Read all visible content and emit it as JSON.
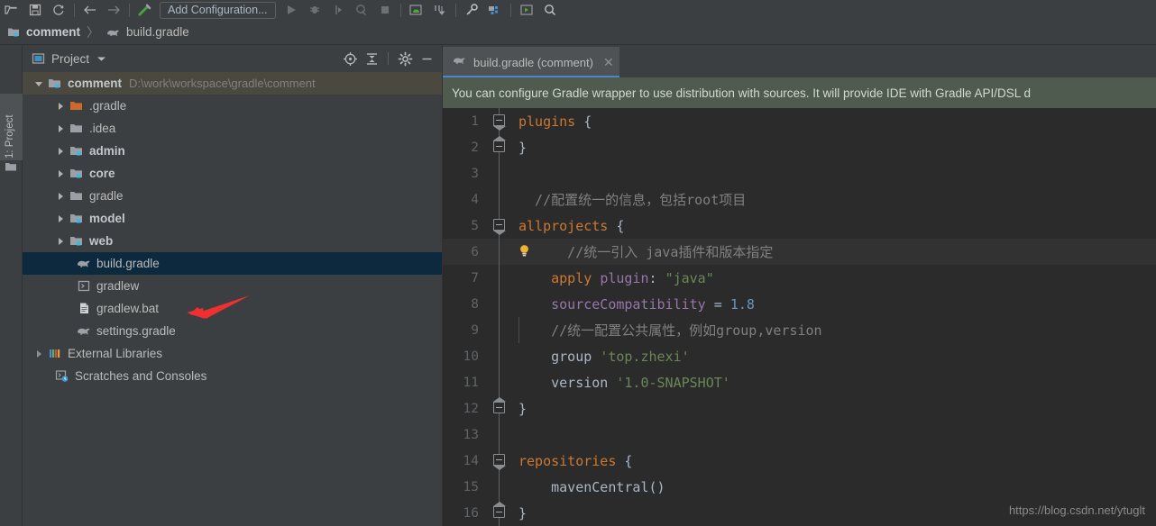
{
  "toolbar": {
    "icons": [
      {
        "name": "open-folder-icon"
      },
      {
        "name": "save-all-icon"
      },
      {
        "name": "sync-refresh-icon"
      },
      {
        "name": "back-arrow-icon"
      },
      {
        "name": "forward-arrow-icon"
      },
      {
        "name": "build-hammer-icon"
      }
    ],
    "run_config_label": "Add Configuration...",
    "right_icons": [
      {
        "name": "run-icon"
      },
      {
        "name": "debug-icon"
      },
      {
        "name": "run-with-coverage-icon"
      },
      {
        "name": "profile-icon"
      },
      {
        "name": "stop-icon"
      },
      {
        "name": "avd-manager-icon"
      },
      {
        "name": "sdk-manager-icon"
      },
      {
        "name": "search-everywhere-key-icon"
      },
      {
        "name": "project-structure-icon"
      },
      {
        "name": "run-anything-icon"
      },
      {
        "name": "search-icon"
      }
    ]
  },
  "breadcrumb": {
    "project_name": "comment",
    "separator": "〉",
    "file_name": "build.gradle"
  },
  "left_strip": {
    "project_tab_label": "1: Project",
    "structure_icon": "folder-icon"
  },
  "project_panel": {
    "title": "Project",
    "dropdown_icon": "chevron-down-icon",
    "actions": [
      {
        "name": "scroll-from-source-icon"
      },
      {
        "name": "collapse-all-icon"
      },
      {
        "name": "settings-gear-icon"
      },
      {
        "name": "hide-panel-icon"
      }
    ],
    "tree": [
      {
        "label": "comment",
        "path": "D:\\work\\workspace\\gradle\\comment",
        "icon": "module-folder-icon",
        "indent": 0,
        "arrow": "expanded",
        "bold": true,
        "state": "root"
      },
      {
        "label": ".gradle",
        "icon": "excluded-folder-icon",
        "indent": 1,
        "arrow": "collapsed",
        "bold": false,
        "state": "normal"
      },
      {
        "label": ".idea",
        "icon": "folder-icon",
        "indent": 1,
        "arrow": "collapsed",
        "bold": false,
        "state": "normal"
      },
      {
        "label": "admin",
        "icon": "module-folder-icon",
        "indent": 1,
        "arrow": "collapsed",
        "bold": true,
        "state": "normal"
      },
      {
        "label": "core",
        "icon": "module-folder-icon",
        "indent": 1,
        "arrow": "collapsed",
        "bold": true,
        "state": "normal"
      },
      {
        "label": "gradle",
        "icon": "folder-icon",
        "indent": 1,
        "arrow": "collapsed",
        "bold": false,
        "state": "normal"
      },
      {
        "label": "model",
        "icon": "module-folder-icon",
        "indent": 1,
        "arrow": "collapsed",
        "bold": true,
        "state": "normal"
      },
      {
        "label": "web",
        "icon": "module-folder-icon",
        "indent": 1,
        "arrow": "collapsed",
        "bold": true,
        "state": "normal"
      },
      {
        "label": "build.gradle",
        "icon": "gradle-elephant-icon",
        "indent": 2,
        "arrow": "none",
        "bold": false,
        "state": "selected"
      },
      {
        "label": "gradlew",
        "icon": "script-icon",
        "indent": 2,
        "arrow": "none",
        "bold": false,
        "state": "normal"
      },
      {
        "label": "gradlew.bat",
        "icon": "bat-file-icon",
        "indent": 2,
        "arrow": "none",
        "bold": false,
        "state": "normal"
      },
      {
        "label": "settings.gradle",
        "icon": "gradle-elephant-icon",
        "indent": 2,
        "arrow": "none",
        "bold": false,
        "state": "normal"
      },
      {
        "label": "External Libraries",
        "icon": "libraries-icon",
        "indent": 0,
        "arrow": "collapsed",
        "bold": false,
        "state": "normal"
      },
      {
        "label": "Scratches and Consoles",
        "icon": "scratches-icon",
        "indent": 1,
        "arrow": "none",
        "bold": false,
        "state": "normal"
      }
    ]
  },
  "editor": {
    "tab": {
      "icon": "gradle-elephant-icon",
      "label": "build.gradle (comment)",
      "close_icon": "close-icon"
    },
    "notification": "You can configure Gradle wrapper to use distribution with sources. It will provide IDE with Gradle API/DSL d",
    "lines": [
      {
        "no": "1",
        "fold": "open",
        "current": false,
        "bulb": false,
        "tokens": [
          {
            "t": "plugins",
            "c": "k"
          },
          {
            "t": " {",
            "c": "pl"
          }
        ]
      },
      {
        "no": "2",
        "fold": "close",
        "current": false,
        "bulb": false,
        "tokens": [
          {
            "t": "}",
            "c": "pl"
          }
        ]
      },
      {
        "no": "3",
        "fold": "none",
        "current": false,
        "bulb": false,
        "tokens": []
      },
      {
        "no": "4",
        "fold": "none",
        "current": false,
        "bulb": false,
        "tokens": [
          {
            "t": "  //配置统一的信息，包括root项目",
            "c": "com"
          }
        ]
      },
      {
        "no": "5",
        "fold": "open",
        "current": false,
        "bulb": false,
        "tokens": [
          {
            "t": "allprojects",
            "c": "k"
          },
          {
            "t": " {",
            "c": "pl"
          }
        ]
      },
      {
        "no": "6",
        "fold": "none",
        "current": true,
        "bulb": true,
        "tokens": [
          {
            "t": "      //统一引入 java插件和版本指定",
            "c": "com"
          }
        ]
      },
      {
        "no": "7",
        "fold": "none",
        "current": false,
        "bulb": false,
        "tokens": [
          {
            "t": "    ",
            "c": "pl"
          },
          {
            "t": "apply",
            "c": "k"
          },
          {
            "t": " ",
            "c": "pl"
          },
          {
            "t": "plugin",
            "c": "fld"
          },
          {
            "t": ": ",
            "c": "pl"
          },
          {
            "t": "\"java\"",
            "c": "str"
          }
        ]
      },
      {
        "no": "8",
        "fold": "none",
        "current": false,
        "bulb": false,
        "tokens": [
          {
            "t": "    ",
            "c": "pl"
          },
          {
            "t": "sourceCompatibility",
            "c": "fld"
          },
          {
            "t": " = ",
            "c": "pl"
          },
          {
            "t": "1.8",
            "c": "num"
          }
        ]
      },
      {
        "no": "9",
        "fold": "none",
        "current": false,
        "bulb": false,
        "tokens": [
          {
            "t": "    //统一配置公共属性，例如group,version",
            "c": "com"
          }
        ]
      },
      {
        "no": "10",
        "fold": "none",
        "current": false,
        "bulb": false,
        "tokens": [
          {
            "t": "    ",
            "c": "pl"
          },
          {
            "t": "group",
            "c": "fn"
          },
          {
            "t": " ",
            "c": "pl"
          },
          {
            "t": "'top.zhexi'",
            "c": "str"
          }
        ]
      },
      {
        "no": "11",
        "fold": "none",
        "current": false,
        "bulb": false,
        "tokens": [
          {
            "t": "    ",
            "c": "pl"
          },
          {
            "t": "version",
            "c": "fn"
          },
          {
            "t": " ",
            "c": "pl"
          },
          {
            "t": "'1.0-SNAPSHOT'",
            "c": "str"
          }
        ]
      },
      {
        "no": "12",
        "fold": "close",
        "current": false,
        "bulb": false,
        "tokens": [
          {
            "t": "}",
            "c": "pl"
          }
        ]
      },
      {
        "no": "13",
        "fold": "none",
        "current": false,
        "bulb": false,
        "tokens": []
      },
      {
        "no": "14",
        "fold": "open",
        "current": false,
        "bulb": false,
        "tokens": [
          {
            "t": "repositories",
            "c": "k"
          },
          {
            "t": " {",
            "c": "pl"
          }
        ]
      },
      {
        "no": "15",
        "fold": "none",
        "current": false,
        "bulb": false,
        "tokens": [
          {
            "t": "    ",
            "c": "pl"
          },
          {
            "t": "mavenCentral",
            "c": "fn"
          },
          {
            "t": "()",
            "c": "pl"
          }
        ]
      },
      {
        "no": "16",
        "fold": "close",
        "current": false,
        "bulb": false,
        "tokens": [
          {
            "t": "}",
            "c": "pl"
          }
        ]
      }
    ]
  },
  "watermark": "https://blog.csdn.net/ytuglt",
  "colors": {
    "chrome_bg": "#3c3f41",
    "editor_bg": "#2b2b2b",
    "selection_blue": "#0d293e",
    "root_highlight": "#4b483f",
    "tab_active": "#4e5254",
    "tab_underline": "#4a88c7",
    "notification_bg": "#4e5b4e",
    "annotation_red": "#f03030",
    "keyword_orange": "#cc7832",
    "string_green": "#6a8759",
    "number_blue": "#6897bb",
    "comment_gray": "#808080",
    "field_purple": "#9876aa"
  }
}
